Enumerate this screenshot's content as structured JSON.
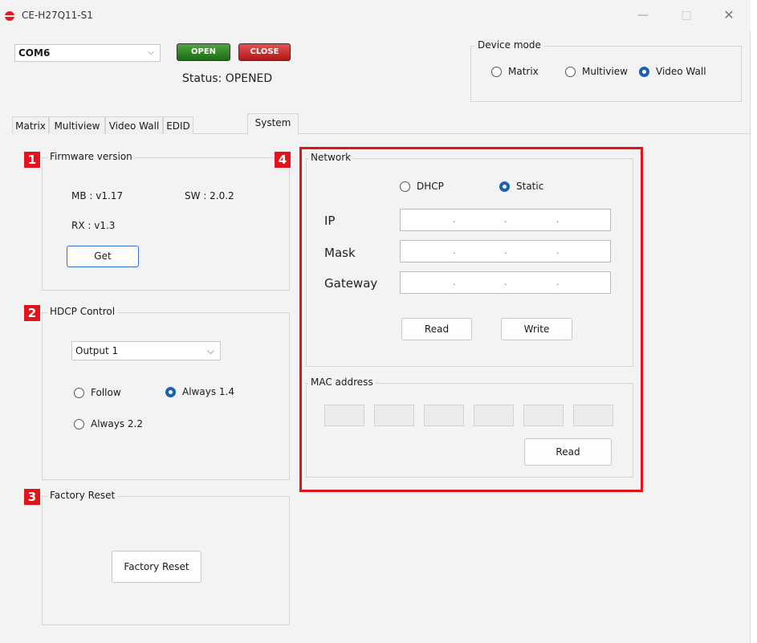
{
  "window": {
    "title": "CE-H27Q11-S1",
    "controls": {
      "minimize": "—",
      "maximize": "□",
      "close": "✕"
    }
  },
  "connection": {
    "port": "COM6",
    "open_label": "OPEN",
    "close_label": "CLOSE",
    "status": "Status:  OPENED"
  },
  "device_mode": {
    "title": "Device mode",
    "options": [
      "Matrix",
      "Multiview",
      "Video Wall"
    ],
    "selected": "Video Wall"
  },
  "tabs": [
    "Matrix",
    "Multiview",
    "Video Wall",
    "EDID",
    "System"
  ],
  "active_tab": "System",
  "markers": [
    "1",
    "2",
    "3",
    "4"
  ],
  "firmware": {
    "title": "Firmware version",
    "mb": "MB : v1.17",
    "sw": "SW : 2.0.2",
    "rx": "RX : v1.3",
    "get_label": "Get"
  },
  "hdcp": {
    "title": "HDCP Control",
    "output": "Output 1",
    "options": [
      "Follow",
      "Always 1.4",
      "Always 2.2"
    ],
    "selected": "Always 1.4"
  },
  "factory": {
    "title": "Factory Reset",
    "button_label": "Factory Reset"
  },
  "network": {
    "title": "Network",
    "modes": [
      "DHCP",
      "Static"
    ],
    "selected": "Static",
    "fields": [
      "IP",
      "Mask",
      "Gateway"
    ],
    "read_label": "Read",
    "write_label": "Write"
  },
  "mac": {
    "title": "MAC address",
    "read_label": "Read"
  },
  "colors": {
    "accent": "#1f5fb8",
    "highlight": "#e0151b",
    "open_green": "#2e8a22",
    "close_red": "#c82424"
  }
}
